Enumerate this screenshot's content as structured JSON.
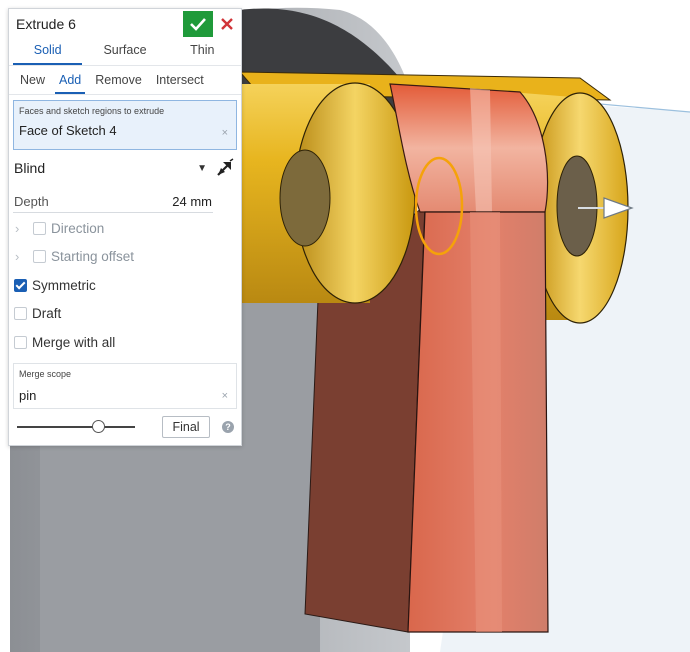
{
  "viewport": {
    "description_icon": "3d-cad-viewport"
  },
  "dialog": {
    "title": "Extrude 6",
    "type_tabs": [
      {
        "label": "Solid",
        "active": true
      },
      {
        "label": "Surface",
        "active": false
      },
      {
        "label": "Thin",
        "active": false
      }
    ],
    "operation_tabs": [
      {
        "label": "New",
        "active": false
      },
      {
        "label": "Add",
        "active": true
      },
      {
        "label": "Remove",
        "active": false
      },
      {
        "label": "Intersect",
        "active": false
      }
    ],
    "selection": {
      "label": "Faces and sketch regions to extrude",
      "value": "Face of Sketch 4",
      "clear": "×"
    },
    "end_type": "Blind",
    "depth": {
      "label": "Depth",
      "value": "24 mm"
    },
    "options": {
      "direction": "Direction",
      "starting_offset": "Starting offset",
      "symmetric": "Symmetric",
      "draft": "Draft",
      "merge_with_all": "Merge with all"
    },
    "merge_scope": {
      "label": "Merge scope",
      "value": "pin",
      "clear": "×"
    },
    "final_label": "Final",
    "help": "?"
  },
  "colors": {
    "accent": "#1a5fb4",
    "ok": "#1f9a3a",
    "cancel": "#d13438",
    "part_yellow": "#e8b323",
    "part_red": "#d9745c",
    "part_dark_red": "#8a4a3a"
  }
}
